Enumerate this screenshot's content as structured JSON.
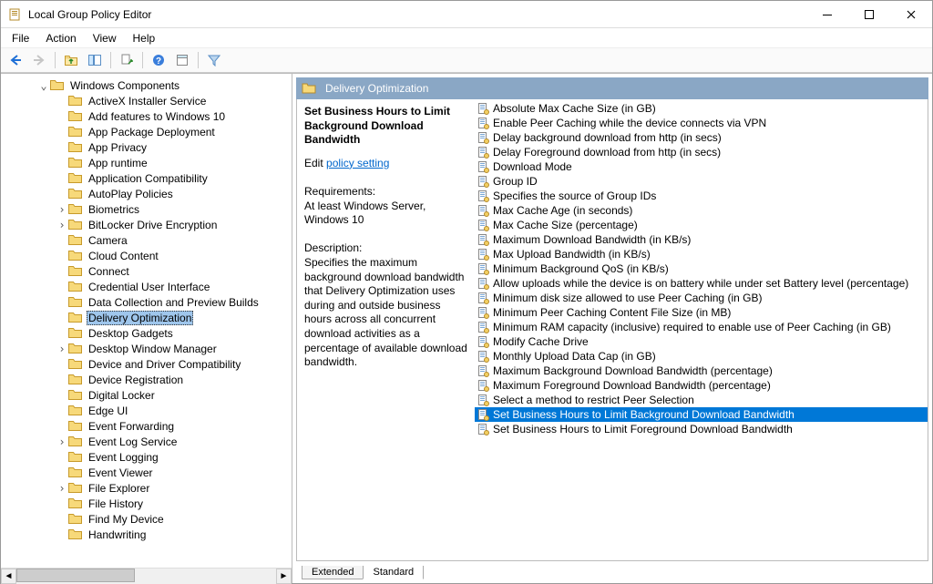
{
  "window": {
    "title": "Local Group Policy Editor"
  },
  "menu": {
    "file": "File",
    "action": "Action",
    "view": "View",
    "help": "Help"
  },
  "toolbar": {
    "back": "back",
    "forward": "forward",
    "up": "up",
    "show_hide_tree": "show-hide-console-tree",
    "export": "export-list",
    "help": "help",
    "properties": "properties",
    "filter": "filter"
  },
  "tree": {
    "root": {
      "label": "Windows Components",
      "expanded": true
    },
    "items": [
      {
        "label": "ActiveX Installer Service",
        "expandable": false
      },
      {
        "label": "Add features to Windows 10",
        "expandable": false
      },
      {
        "label": "App Package Deployment",
        "expandable": false
      },
      {
        "label": "App Privacy",
        "expandable": false
      },
      {
        "label": "App runtime",
        "expandable": false
      },
      {
        "label": "Application Compatibility",
        "expandable": false
      },
      {
        "label": "AutoPlay Policies",
        "expandable": false
      },
      {
        "label": "Biometrics",
        "expandable": true
      },
      {
        "label": "BitLocker Drive Encryption",
        "expandable": true
      },
      {
        "label": "Camera",
        "expandable": false
      },
      {
        "label": "Cloud Content",
        "expandable": false
      },
      {
        "label": "Connect",
        "expandable": false
      },
      {
        "label": "Credential User Interface",
        "expandable": false
      },
      {
        "label": "Data Collection and Preview Builds",
        "expandable": false
      },
      {
        "label": "Delivery Optimization",
        "expandable": false,
        "selected": true
      },
      {
        "label": "Desktop Gadgets",
        "expandable": false
      },
      {
        "label": "Desktop Window Manager",
        "expandable": true
      },
      {
        "label": "Device and Driver Compatibility",
        "expandable": false
      },
      {
        "label": "Device Registration",
        "expandable": false
      },
      {
        "label": "Digital Locker",
        "expandable": false
      },
      {
        "label": "Edge UI",
        "expandable": false
      },
      {
        "label": "Event Forwarding",
        "expandable": false
      },
      {
        "label": "Event Log Service",
        "expandable": true
      },
      {
        "label": "Event Logging",
        "expandable": false
      },
      {
        "label": "Event Viewer",
        "expandable": false
      },
      {
        "label": "File Explorer",
        "expandable": true
      },
      {
        "label": "File History",
        "expandable": false
      },
      {
        "label": "Find My Device",
        "expandable": false
      },
      {
        "label": "Handwriting",
        "expandable": false
      }
    ]
  },
  "right_header": {
    "title": "Delivery Optimization"
  },
  "detail": {
    "title": "Set Business Hours to Limit Background Download Bandwidth",
    "edit_prefix": "Edit ",
    "edit_link": "policy setting",
    "requirements_label": "Requirements:",
    "requirements_value": "At least Windows Server, Windows 10",
    "description_label": "Description:",
    "description_value": "Specifies the maximum background download bandwidth that Delivery Optimization uses during and outside business hours across all concurrent download activities as a percentage of available download bandwidth."
  },
  "policies": [
    "Absolute Max Cache Size (in GB)",
    "Enable Peer Caching while the device connects via VPN",
    "Delay background download from http (in secs)",
    "Delay Foreground download from http (in secs)",
    "Download Mode",
    "Group ID",
    "Specifies the source of Group IDs",
    "Max Cache Age (in seconds)",
    "Max Cache Size (percentage)",
    "Maximum Download Bandwidth (in KB/s)",
    "Max Upload Bandwidth (in KB/s)",
    "Minimum Background QoS (in KB/s)",
    "Allow uploads while the device is on battery while under set Battery level (percentage)",
    "Minimum disk size allowed to use Peer Caching (in GB)",
    "Minimum Peer Caching Content File Size (in MB)",
    "Minimum RAM capacity (inclusive) required to enable use of Peer Caching (in GB)",
    "Modify Cache Drive",
    "Monthly Upload Data Cap (in GB)",
    "Maximum Background Download Bandwidth (percentage)",
    "Maximum Foreground Download Bandwidth (percentage)",
    "Select a method to restrict Peer Selection",
    "Set Business Hours to Limit Background Download Bandwidth",
    "Set Business Hours to Limit Foreground Download Bandwidth"
  ],
  "selected_policy_index": 21,
  "tabs": {
    "extended": "Extended",
    "standard": "Standard"
  }
}
